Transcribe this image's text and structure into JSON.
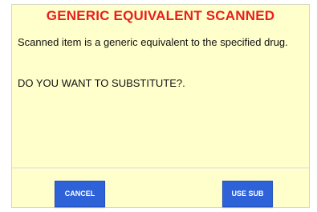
{
  "dialog": {
    "title": "GENERIC EQUIVALENT SCANNED",
    "message": "Scanned item is a generic equivalent to the specified drug.",
    "question": "DO YOU WANT TO SUBSTITUTE?.",
    "buttons": {
      "cancel_label": "CANCEL",
      "use_sub_label": "USE SUB"
    }
  },
  "colors": {
    "background": "#ffffcc",
    "title": "#e8201c",
    "button": "#2e62d9"
  }
}
